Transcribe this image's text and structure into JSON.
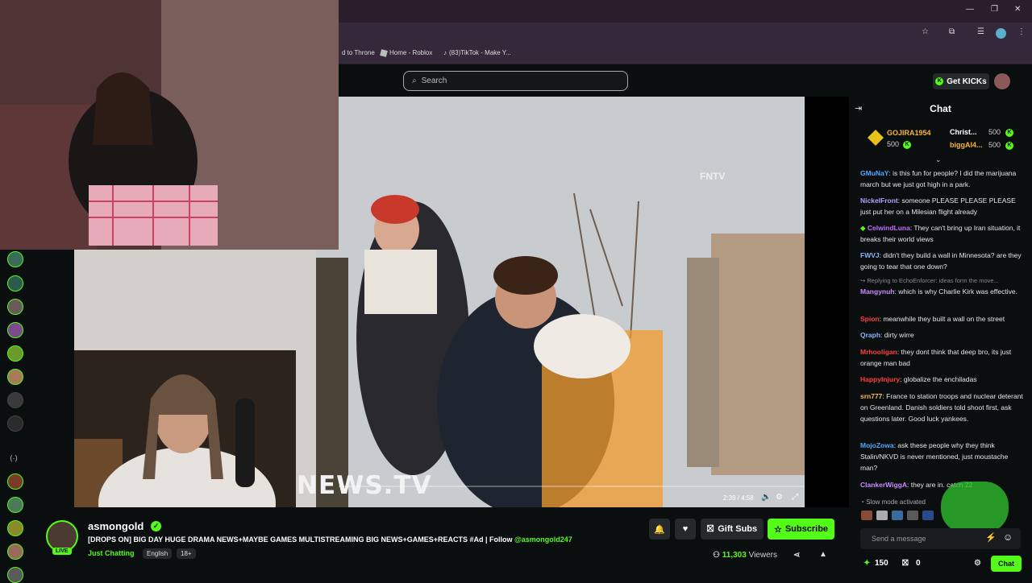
{
  "browser": {
    "bookmarks": [
      "d to Throne",
      "Home - Roblox",
      "(83)TikTok - Make Y..."
    ]
  },
  "header": {
    "search_placeholder": "Search",
    "get_kicks": "Get KICKs"
  },
  "video": {
    "watermark": "FNTV",
    "overlay_text": "NEWS.TV",
    "timecode": "2:39 / 4:58"
  },
  "chat": {
    "title": "Chat",
    "pinned": [
      {
        "user": "GOJIRA1954",
        "amount": "500"
      },
      {
        "user": "Christ...",
        "amount": "500"
      },
      {
        "user": "biggAl4...",
        "amount": "500"
      }
    ],
    "messages": [
      {
        "user": "GMuNaY",
        "text": "is this fun for people? I did the marijuana march but we just got high in a park.",
        "color": "#53a8fc"
      },
      {
        "user": "NickelFront",
        "text": "someone PLEASE PLEASE PLEASE just put her on a Milesian flight already",
        "color": "#a8a8ff"
      },
      {
        "user": "CelwindLuna",
        "text": "They can't bring up Iran situation, it breaks their world views",
        "color": "#c46cff"
      },
      {
        "user": "FWVJ",
        "text": "didn't they build a wall in Minnesota? are they going to tear that one down?",
        "color": "#8ab4ff"
      },
      {
        "user": "",
        "text": "Replying to EchoEnforcer: ideas form the move...",
        "color": "#888"
      },
      {
        "user": "Mangynuh",
        "text": "which is why Charlie Kirk was effective.",
        "color": "#c98cff"
      },
      {
        "user": "Spion",
        "text": "meanwhile they built a wall on the street",
        "color": "#ff4040"
      },
      {
        "user": "Qraph",
        "text": "dirty wirre",
        "color": "#8ab4ff"
      },
      {
        "user": "Mrhooligan",
        "text": "they dont think that deep bro, its just orange man bad",
        "color": "#ff4040"
      },
      {
        "user": "HappyInjury",
        "text": "globalize the enchiladas",
        "color": "#ff4040"
      },
      {
        "user": "srn777",
        "text": "France to station troops and nuclear deterant on Greenland. Danish soldiers told shoot first, ask questions later. Good luck yankees.",
        "color": "#ffb84d"
      },
      {
        "user": "MojoZowa",
        "text": "ask these people why they think Stalin/NKVD is never mentioned, just moustache man?",
        "color": "#53a8fc"
      },
      {
        "user": "ClankerWiggA",
        "text": "they are in. catch 22",
        "color": "#c98cff"
      }
    ],
    "slow_mode": "Slow mode activated",
    "input_placeholder": "Send a message",
    "points": "150",
    "gifts": "0",
    "chat_button": "Chat"
  },
  "stream": {
    "streamer": "asmongold",
    "live_label": "LIVE",
    "title": "[DROPS ON] BIG DAY HUGE DRAMA NEWS+MAYBE GAMES MULTISTREAMING BIG NEWS+GAMES+REACTS #Ad | Follow",
    "handle": "@asmongold247",
    "category": "Just Chatting",
    "tags": [
      "English",
      "18+"
    ],
    "gift_subs": "Gift Subs",
    "subscribe": "Subscribe",
    "viewers": "11,303",
    "viewers_label": "Viewers"
  },
  "colors": {
    "accent": "#53fc18",
    "background": "#0b0e0f"
  }
}
